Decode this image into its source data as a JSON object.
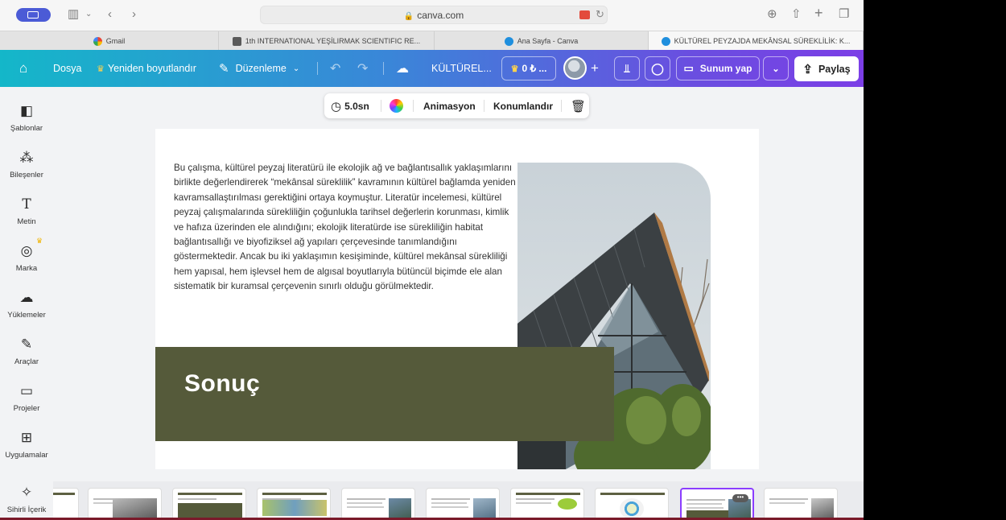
{
  "browser": {
    "url": "canva.com",
    "tabs": [
      {
        "label": "Gmail",
        "icon": "gmail-icon"
      },
      {
        "label": "1th INTERNATIONAL YEŞİLIRMAK SCIENTIFIC RE...",
        "icon": "document-icon"
      },
      {
        "label": "Ana Sayfa - Canva",
        "icon": "canva-icon"
      },
      {
        "label": "KÜLTÜREL PEYZAJDA MEKÂNSAL SÜREKLİLİK: K...",
        "icon": "canva-icon",
        "active": true
      }
    ]
  },
  "toolbar": {
    "file": "Dosya",
    "resize": "Yeniden boyutlandır",
    "edit": "Düzenleme",
    "doc_title": "KÜLTÜREL...",
    "credits": "0 ₺ ...",
    "present": "Sunum yap",
    "share": "Paylaş",
    "colors": {
      "gradient_start": "#14b7c9",
      "gradient_end": "#7b3ee6",
      "crown": "#ffd34d"
    }
  },
  "sidebar": {
    "items": [
      {
        "label": "Şablonlar",
        "icon": "templates-icon"
      },
      {
        "label": "Bileşenler",
        "icon": "elements-icon"
      },
      {
        "label": "Metin",
        "icon": "text-icon"
      },
      {
        "label": "Marka",
        "icon": "brand-icon"
      },
      {
        "label": "Yüklemeler",
        "icon": "upload-icon"
      },
      {
        "label": "Araçlar",
        "icon": "tools-icon"
      },
      {
        "label": "Projeler",
        "icon": "folder-icon"
      },
      {
        "label": "Uygulamalar",
        "icon": "apps-icon"
      },
      {
        "label": "Sihirli İçerik",
        "icon": "magic-icon"
      }
    ]
  },
  "element_toolbar": {
    "duration": "5.0sn",
    "animation": "Animasyon",
    "position": "Konumlandır"
  },
  "slide": {
    "body": "Bu çalışma, kültürel peyzaj literatürü ile ekolojik ağ ve bağlantısallık yaklaşımlarını birlikte değerlendirerek “mekânsal süreklilik” kavramının kültürel bağlamda yeniden kavramsallaştırılması gerektiğini ortaya koymuştur. Literatür incelemesi, kültürel peyzaj çalışmalarında sürekliliğin çoğunlukla tarihsel değerlerin korunması, kimlik ve hafıza üzerinden ele alındığını; ekolojik literatürde ise sürekliliğin habitat bağlantısallığı ve biyofiziksel ağ yapıları çerçevesinde tanımlandığını göstermektedir. Ancak bu iki yaklaşımın kesişiminde, kültürel mekânsal sürekliliği hem yapısal, hem işlevsel hem de algısal boyutlarıyla bütüncül biçimde ele alan sistematik bir kuramsal çerçevenin sınırlı olduğu görülmektedir.",
    "heading": "Sonuç",
    "colors": {
      "band": "#555a3a"
    }
  },
  "pages": {
    "count_visible": 9,
    "selected_index": 7
  }
}
